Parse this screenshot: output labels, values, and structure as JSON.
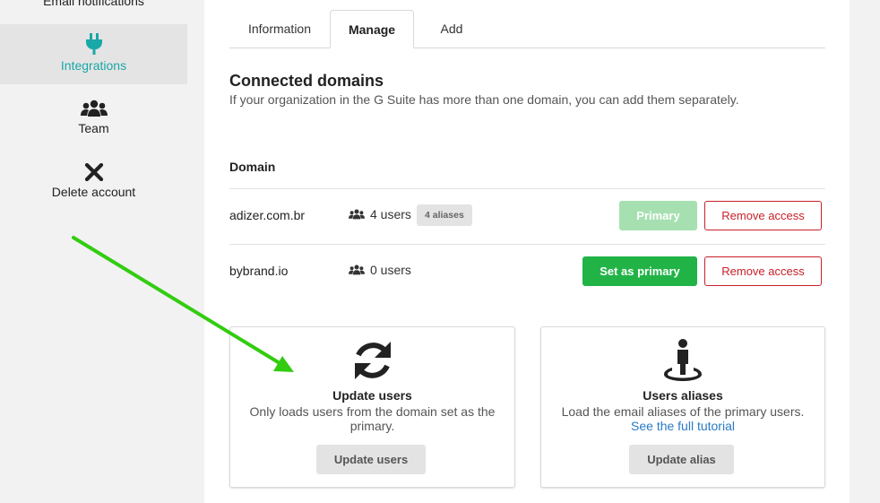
{
  "sidebar": {
    "email_notifications": "Email notifications",
    "integrations": "Integrations",
    "team": "Team",
    "delete_account": "Delete account",
    "active_color": "#1aa7a7"
  },
  "tabs": {
    "information": "Information",
    "manage": "Manage",
    "add": "Add",
    "active": "Manage"
  },
  "connected": {
    "title": "Connected domains",
    "subtitle": "If your organization in the G Suite has more than one domain, you can add them separately."
  },
  "domains": {
    "column_header": "Domain",
    "rows": [
      {
        "name": "adizer.com.br",
        "users": "4 users",
        "aliases": "4 aliases",
        "primary_label": "Primary",
        "remove_label": "Remove access"
      },
      {
        "name": "bybrand.io",
        "users": "0 users",
        "set_primary_label": "Set as primary",
        "remove_label": "Remove access"
      }
    ]
  },
  "cards": {
    "update_users": {
      "icon": "sync-icon",
      "title": "Update users",
      "description": "Only loads users from the domain set as the primary.",
      "button": "Update users"
    },
    "users_aliases": {
      "icon": "user-location-icon",
      "title": "Users aliases",
      "description": "Load the email aliases of the primary users.",
      "link": "See the full tutorial",
      "button": "Update alias"
    }
  },
  "colors": {
    "primary_green": "#22b347",
    "primary_disabled": "#a6e0b0",
    "danger": "#c8202a",
    "link": "#2a7ac4",
    "annotation_arrow": "#33cc11"
  }
}
